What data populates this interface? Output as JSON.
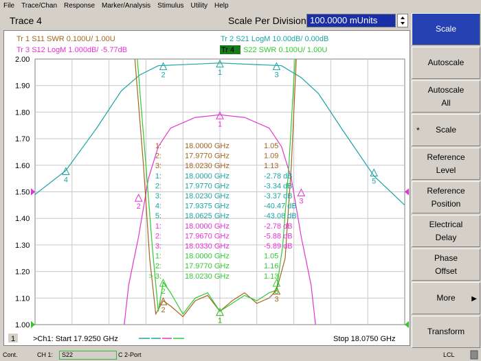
{
  "menu": [
    "File",
    "Trace/Chan",
    "Response",
    "Marker/Analysis",
    "Stimulus",
    "Utility",
    "Help"
  ],
  "toolbar": {
    "trace_title": "Trace 4",
    "spd_label": "Scale Per Division",
    "spd_value": "100.0000 mUnits"
  },
  "traces": [
    {
      "text": "Tr  1  S11 SWR 0.100U/  1.00U",
      "color": "#a0651e"
    },
    {
      "text": "Tr  2  S21 LogM 10.00dB/  0.00dB",
      "color": "#1aa3a3"
    },
    {
      "text": "Tr  3  S12 LogM 1.000dB/  -5.77dB",
      "color": "#e62fd4"
    },
    {
      "text": "S22 SWR 0.100U/  1.00U",
      "color": "#32c832",
      "badge": "Tr  4"
    }
  ],
  "yticks": [
    "2.00",
    "1.90",
    "1.80",
    "1.70",
    "1.60",
    "1.50",
    "1.40",
    "1.30",
    "1.20",
    "1.10",
    "1.00"
  ],
  "markers": [
    {
      "n": "1:",
      "f": "18.0000 GHz",
      "v": "1.05",
      "color": "#a0651e"
    },
    {
      "n": "2:",
      "f": "17.9770 GHz",
      "v": "1.09",
      "color": "#a0651e"
    },
    {
      "n": "3:",
      "f": "18.0230 GHz",
      "v": "1.13",
      "color": "#a0651e"
    },
    {
      "n": "1:",
      "f": "18.0000 GHz",
      "v": "-2.78 dB",
      "color": "#1aa3a3"
    },
    {
      "n": "2:",
      "f": "17.9770 GHz",
      "v": "-3.34 dB",
      "color": "#1aa3a3"
    },
    {
      "n": "3:",
      "f": "18.0230 GHz",
      "v": "-3.37 dB",
      "color": "#1aa3a3"
    },
    {
      "n": "4:",
      "f": "17.9375 GHz",
      "v": "-40.47 dB",
      "color": "#1aa3a3"
    },
    {
      "n": "5:",
      "f": "18.0625 GHz",
      "v": "-43.08 dB",
      "color": "#1aa3a3"
    },
    {
      "n": "1:",
      "f": "18.0000 GHz",
      "v": "-2.78 dB",
      "color": "#e62fd4"
    },
    {
      "n": "2:",
      "f": "17.9670 GHz",
      "v": "-5.88 dB",
      "color": "#e62fd4"
    },
    {
      "n": "3:",
      "f": "18.0330 GHz",
      "v": "-5.89 dB",
      "color": "#e62fd4"
    },
    {
      "n": "1:",
      "f": "18.0000 GHz",
      "v": "1.05",
      "color": "#32c832"
    },
    {
      "n": "2:",
      "f": "17.9770 GHz",
      "v": "1.16",
      "color": "#32c832"
    },
    {
      "n": "> 3:",
      "f": "18.0230 GHz",
      "v": "1.13",
      "color": "#32c832"
    }
  ],
  "bottom": {
    "ch_num": "1",
    "start": ">Ch1: Start  17.9250 GHz",
    "stop": "Stop  18.0750 GHz"
  },
  "status": {
    "cont": "Cont.",
    "ch1": "CH 1:",
    "s22": "S22",
    "port": "C  2-Port",
    "lcl": "LCL"
  },
  "softkeys": [
    {
      "label": "Scale",
      "active": true
    },
    {
      "label": "Autoscale"
    },
    {
      "label": "Autoscale\nAll"
    },
    {
      "label": "Scale",
      "star": "*"
    },
    {
      "label": "Reference\nLevel"
    },
    {
      "label": "Reference\nPosition"
    },
    {
      "label": "Electrical\nDelay"
    },
    {
      "label": "Phase\nOffset"
    },
    {
      "label": "More",
      "arrow": true
    },
    {
      "label": "Transform"
    }
  ],
  "chart_data": {
    "type": "line",
    "xlim": [
      17.925,
      18.075
    ],
    "ylim": [
      1.0,
      2.0
    ],
    "grid": true,
    "series": [
      {
        "name": "S21",
        "color": "#1aa3a3",
        "values": [
          [
            17.925,
            1.49
          ],
          [
            17.9375,
            1.58
          ],
          [
            17.95,
            1.74
          ],
          [
            17.96,
            1.88
          ],
          [
            17.9675,
            1.94
          ],
          [
            17.975,
            1.975
          ],
          [
            18.0,
            1.985
          ],
          [
            18.025,
            1.975
          ],
          [
            18.033,
            1.93
          ],
          [
            18.04,
            1.87
          ],
          [
            18.05,
            1.73
          ],
          [
            18.0625,
            1.56
          ],
          [
            18.075,
            1.45
          ]
        ]
      },
      {
        "name": "S12",
        "color": "#e62fd4",
        "values": [
          [
            17.9612,
            1.0
          ],
          [
            17.963,
            1.15
          ],
          [
            17.967,
            1.33
          ],
          [
            17.971,
            1.55
          ],
          [
            17.975,
            1.67
          ],
          [
            17.98,
            1.74
          ],
          [
            17.99,
            1.78
          ],
          [
            18.0,
            1.79
          ],
          [
            18.01,
            1.78
          ],
          [
            18.02,
            1.74
          ],
          [
            18.025,
            1.67
          ],
          [
            18.029,
            1.55
          ],
          [
            18.033,
            1.33
          ],
          [
            18.037,
            1.15
          ],
          [
            18.0388,
            1.0
          ]
        ]
      },
      {
        "name": "S11",
        "color": "#a0651e",
        "values": [
          [
            17.9655,
            2.0
          ],
          [
            17.969,
            1.6
          ],
          [
            17.9715,
            1.25
          ],
          [
            17.974,
            1.04
          ],
          [
            17.977,
            1.09
          ],
          [
            17.98,
            1.07
          ],
          [
            17.985,
            1.03
          ],
          [
            17.99,
            1.09
          ],
          [
            17.995,
            1.11
          ],
          [
            18.0,
            1.05
          ],
          [
            18.005,
            1.09
          ],
          [
            18.01,
            1.12
          ],
          [
            18.015,
            1.08
          ],
          [
            18.02,
            1.1
          ],
          [
            18.023,
            1.13
          ],
          [
            18.0265,
            1.25
          ],
          [
            18.029,
            1.6
          ],
          [
            18.031,
            2.0
          ]
        ]
      },
      {
        "name": "S22",
        "color": "#32c832",
        "values": [
          [
            17.9665,
            2.0
          ],
          [
            17.97,
            1.6
          ],
          [
            17.9725,
            1.3
          ],
          [
            17.975,
            1.05
          ],
          [
            17.977,
            1.16
          ],
          [
            17.98,
            1.12
          ],
          [
            17.985,
            1.04
          ],
          [
            17.99,
            1.1
          ],
          [
            17.995,
            1.12
          ],
          [
            18.0,
            1.05
          ],
          [
            18.005,
            1.08
          ],
          [
            18.01,
            1.11
          ],
          [
            18.015,
            1.09
          ],
          [
            18.02,
            1.12
          ],
          [
            18.023,
            1.13
          ],
          [
            18.0255,
            1.3
          ],
          [
            18.028,
            1.6
          ],
          [
            18.0305,
            2.0
          ]
        ]
      }
    ],
    "marker_points": [
      {
        "series": "S11",
        "label": "1",
        "x": 18.0,
        "y": 1.05
      },
      {
        "series": "S11",
        "label": "2",
        "x": 17.977,
        "y": 1.09
      },
      {
        "series": "S11",
        "label": "3",
        "x": 18.023,
        "y": 1.13
      },
      {
        "series": "S21",
        "label": "1",
        "x": 18.0,
        "y": 1.985
      },
      {
        "series": "S21",
        "label": "2",
        "x": 17.977,
        "y": 1.975
      },
      {
        "series": "S21",
        "label": "3",
        "x": 18.023,
        "y": 1.975
      },
      {
        "series": "S21",
        "label": "4",
        "x": 17.9375,
        "y": 1.58
      },
      {
        "series": "S21",
        "label": "5",
        "x": 18.0625,
        "y": 1.575
      },
      {
        "series": "S12",
        "label": "1",
        "x": 18.0,
        "y": 1.79
      },
      {
        "series": "S12",
        "label": "2",
        "x": 17.967,
        "y": 1.48
      },
      {
        "series": "S12",
        "label": "3",
        "x": 18.033,
        "y": 1.5
      },
      {
        "series": "S22",
        "label": "1",
        "x": 18.0,
        "y": 1.05
      },
      {
        "series": "S22",
        "label": "2",
        "x": 17.977,
        "y": 1.16
      },
      {
        "series": "S22",
        "label": "3",
        "x": 18.023,
        "y": 1.16
      }
    ],
    "reference_arrows": [
      {
        "color": "#1aa3a3",
        "y": 1.5
      },
      {
        "color": "#e62fd4",
        "y": 1.5
      },
      {
        "color": "#a0651e",
        "y": 1.0
      },
      {
        "color": "#32c832",
        "y": 1.0
      }
    ]
  }
}
